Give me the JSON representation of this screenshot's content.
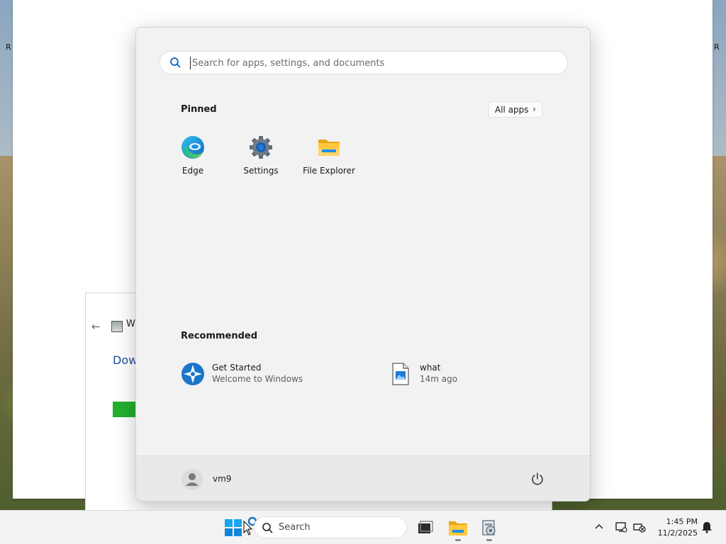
{
  "desktop": {
    "left_edge_text": "R",
    "right_edge_text": "R"
  },
  "background_dialog": {
    "back_arrow": "←",
    "title": "Wi",
    "link_text": "Dow"
  },
  "start_menu": {
    "search": {
      "placeholder": "Search for apps, settings, and documents",
      "value": ""
    },
    "pinned": {
      "title": "Pinned",
      "all_apps_label": "All apps",
      "all_apps_chevron": "›",
      "apps": [
        {
          "label": "Edge",
          "icon": "edge-icon"
        },
        {
          "label": "Settings",
          "icon": "gear-icon"
        },
        {
          "label": "File Explorer",
          "icon": "folder-icon"
        }
      ]
    },
    "recommended": {
      "title": "Recommended",
      "items": [
        {
          "title": "Get Started",
          "subtitle": "Welcome to Windows",
          "icon": "get-started-icon"
        },
        {
          "title": "what",
          "subtitle": "14m ago",
          "icon": "image-file-icon"
        }
      ]
    },
    "footer": {
      "user_name": "vm9",
      "power_icon": "power-icon"
    }
  },
  "taskbar": {
    "search_label": "Search",
    "clock_time": "1:45 PM",
    "clock_date": "11/2/2025",
    "icons": [
      "windows-start-icon",
      "search-icon",
      "task-view-icon",
      "file-explorer-icon",
      "installer-icon",
      "chevron-up-icon",
      "network-icon",
      "battery-icon",
      "notification-icon"
    ]
  },
  "colors": {
    "accent": "#0067c0",
    "start_bg": "#f2f2f2",
    "taskbar_bg": "#f3f3f3",
    "progress_green": "#22b02e"
  }
}
